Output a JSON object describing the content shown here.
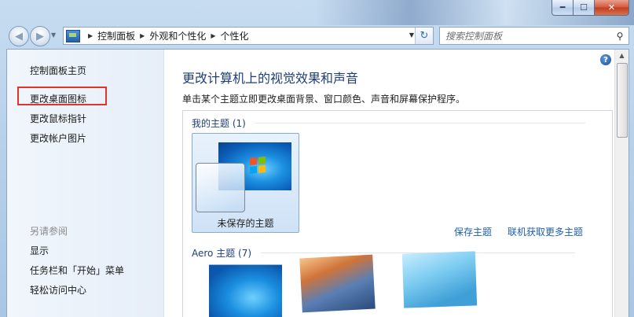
{
  "window": {
    "controls": {
      "minimize_icon": "minimize-icon",
      "maximize_icon": "maximize-icon",
      "close_icon": "close-icon"
    }
  },
  "navigation": {
    "breadcrumbs": [
      "控制面板",
      "外观和个性化",
      "个性化"
    ],
    "search_placeholder": "搜索控制面板"
  },
  "sidebar": {
    "items": [
      {
        "label": "控制面板主页"
      },
      {
        "label": "更改桌面图标",
        "highlighted": true
      },
      {
        "label": "更改鼠标指针"
      },
      {
        "label": "更改帐户图片"
      }
    ],
    "see_also_heading": "另请参阅",
    "see_also": [
      {
        "label": "显示"
      },
      {
        "label": "任务栏和「开始」菜单"
      },
      {
        "label": "轻松访问中心"
      }
    ]
  },
  "main": {
    "title": "更改计算机上的视觉效果和声音",
    "subtitle": "单击某个主题立即更改桌面背景、窗口颜色、声音和屏幕保护程序。",
    "my_themes": {
      "heading": "我的主题 (1)",
      "themes": [
        {
          "label": "未保存的主题",
          "selected": true
        }
      ]
    },
    "actions": {
      "save_theme": "保存主题",
      "get_more_online": "联机获取更多主题"
    },
    "aero_themes": {
      "heading": "Aero 主题 (7)"
    }
  },
  "colors": {
    "highlight_border": "#e0352b",
    "link": "#1d5fb0",
    "heading": "#1e3e7a"
  }
}
